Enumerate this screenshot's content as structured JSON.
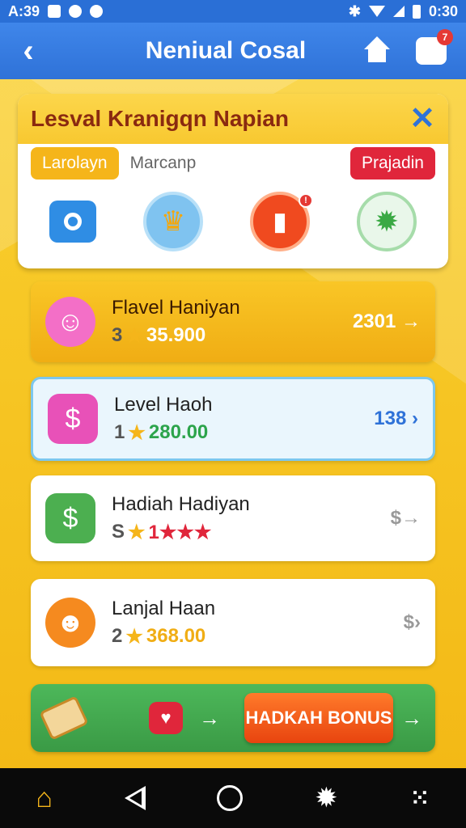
{
  "status_bar": {
    "time_left": "A:39",
    "time_right": "0:30"
  },
  "app_bar": {
    "title": "Neniual Cosal",
    "chat_badge": "7"
  },
  "card": {
    "title": "Lesval Kranigqn Napian",
    "tabs": [
      "Larolayn",
      "Marcanp",
      "Prajadin"
    ],
    "icons": [
      "camera-icon",
      "crown-icon",
      "lock-icon",
      "gear-icon"
    ]
  },
  "list": [
    {
      "title": "Flavel Haniyan",
      "prefix": "3",
      "value": "35.900",
      "right": "2301"
    },
    {
      "title": "Level Haoh",
      "prefix": "1",
      "value": "280.00",
      "right": "138"
    },
    {
      "title": "Hadiah Hadiyan",
      "prefix": "S",
      "value": "1★★★",
      "right": "$"
    },
    {
      "title": "Lanjal Haan",
      "prefix": "2",
      "value": "368.00",
      "right": "$"
    }
  ],
  "bonus": {
    "button_label": "HADKAH BONUS"
  },
  "colors": {
    "accent": "#2f72d8",
    "yellow": "#f5b51a",
    "green": "#3aa944",
    "red": "#e0263b"
  }
}
